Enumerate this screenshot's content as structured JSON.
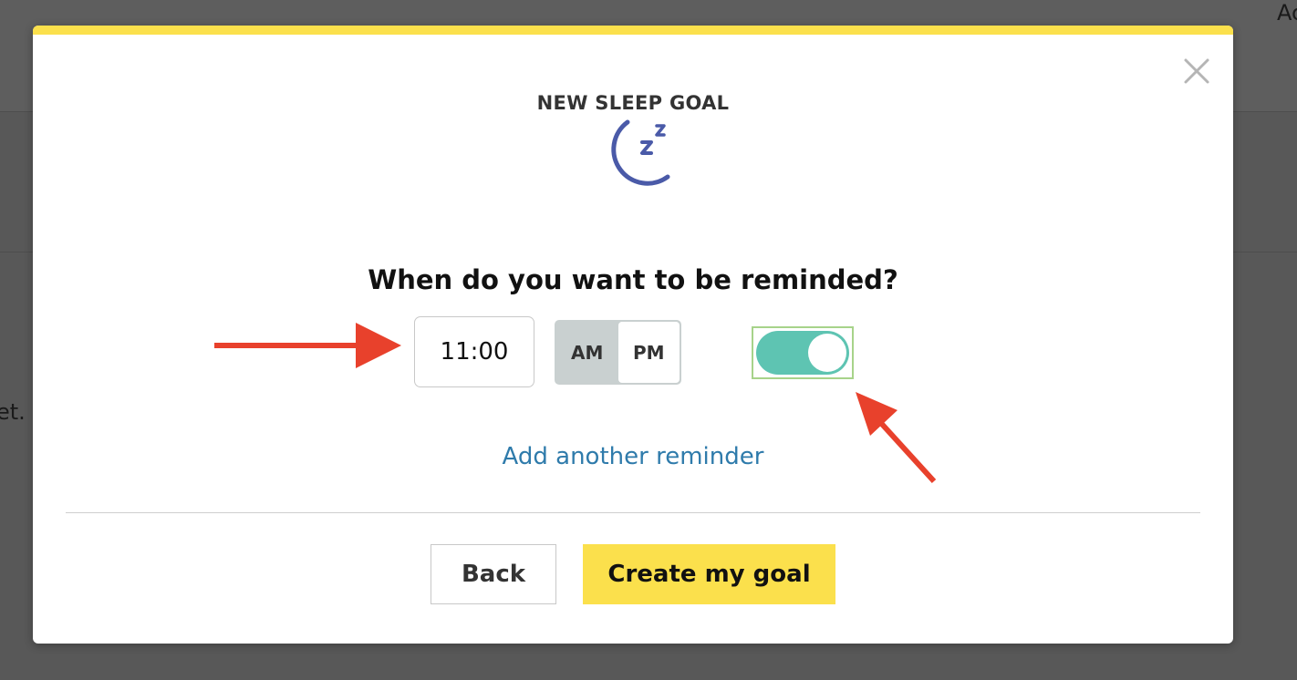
{
  "background": {
    "left_text": "et.",
    "right_text": "Ac"
  },
  "modal": {
    "title": "NEW SLEEP GOAL",
    "icon": "moon-zzz-icon",
    "question": "When do you want to be reminded?",
    "reminder": {
      "time_value": "11:00",
      "am_label": "AM",
      "pm_label": "PM",
      "selected_period": "PM",
      "enabled": true
    },
    "add_reminder_label": "Add another reminder",
    "back_label": "Back",
    "create_label": "Create my goal"
  },
  "colors": {
    "accent_yellow": "#fbe04c",
    "toggle_teal": "#5ec4b2",
    "link_blue": "#2f7bab",
    "icon_indigo": "#4a5aa8",
    "annotation_red": "#e8412c"
  }
}
